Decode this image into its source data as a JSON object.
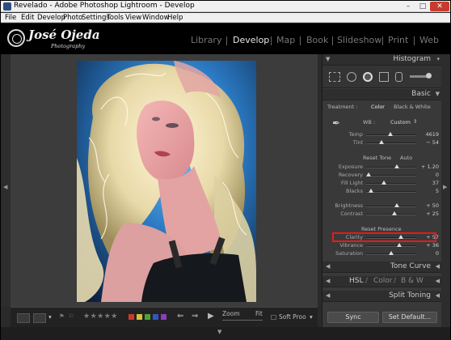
{
  "window": {
    "title": "Revelado - Adobe Photoshop Lightroom - Develop"
  },
  "menu": [
    "File",
    "Edit",
    "Develop",
    "Photo",
    "Settings",
    "Tools",
    "View",
    "Window",
    "Help"
  ],
  "identity": {
    "name": "José Ojeda",
    "subtitle": "Photography"
  },
  "modules": [
    {
      "label": "Library",
      "active": false
    },
    {
      "label": "Develop",
      "active": true
    },
    {
      "label": "Map",
      "active": false
    },
    {
      "label": "Book",
      "active": false
    },
    {
      "label": "Slideshow",
      "active": false
    },
    {
      "label": "Print",
      "active": false
    },
    {
      "label": "Web",
      "active": false
    }
  ],
  "panels": {
    "histogram": "Histogram",
    "basic": "Basic",
    "tone_curve": "Tone Curve",
    "hsl": {
      "hsl": "HSL",
      "sep": "/",
      "color": "Color",
      "bw": "B & W"
    },
    "split_toning": "Split Toning"
  },
  "basic": {
    "treatment_label": "Treatment :",
    "treatment_color": "Color",
    "treatment_bw": "Black & White",
    "wb_label": "WB :",
    "wb_value": "Custom",
    "reset_tone": "Reset Tone",
    "auto": "Auto",
    "reset_presence": "Reset Presence",
    "sliders": [
      {
        "label": "Temp",
        "value": "4619",
        "pos": 0.48
      },
      {
        "label": "Tint",
        "value": "− 54",
        "pos": 0.3
      },
      {
        "label": "Exposure",
        "value": "+ 1.20",
        "pos": 0.62
      },
      {
        "label": "Recovery",
        "value": "0",
        "pos": 0.05
      },
      {
        "label": "Fill Light",
        "value": "37",
        "pos": 0.35
      },
      {
        "label": "Blacks",
        "value": "5",
        "pos": 0.1
      },
      {
        "label": "Brightness",
        "value": "+ 50",
        "pos": 0.62
      },
      {
        "label": "Contrast",
        "value": "+ 25",
        "pos": 0.56
      },
      {
        "label": "Clarity",
        "value": "+ 57",
        "pos": 0.7
      },
      {
        "label": "Vibrance",
        "value": "+ 36",
        "pos": 0.66
      },
      {
        "label": "Saturation",
        "value": "0",
        "pos": 0.5
      }
    ]
  },
  "buttons": {
    "sync": "Sync",
    "set_default": "Set Default..."
  },
  "toolbar": {
    "stars": "★★★★★",
    "zoom_label": "Zoom",
    "zoom_value": "Fit",
    "soft_proof": "Soft Proo",
    "swatches": [
      "#c83a2e",
      "#d6c238",
      "#4aa33a",
      "#3454c4",
      "#8b3fb8"
    ]
  }
}
